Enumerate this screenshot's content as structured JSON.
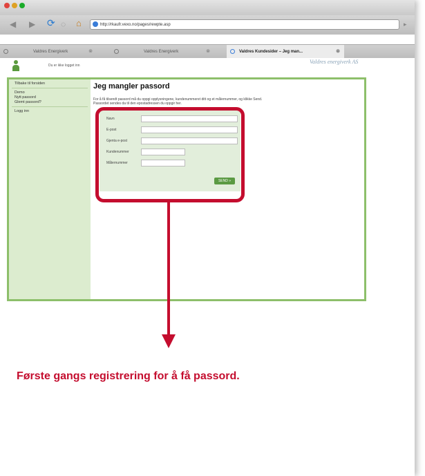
{
  "browser": {
    "url": "http://rkaufr.vexo.no/pages/rewpte.asp",
    "tabs": [
      {
        "label": "Valdres Energiverk"
      },
      {
        "label": "Valdres Energiverk"
      },
      {
        "label": "Valdres Kundesider – Jeg man..."
      }
    ]
  },
  "header": {
    "status": "Du er ikke logget inn",
    "logo_text": "Valdres energiverk AS"
  },
  "sidebar": {
    "items": [
      {
        "label": "Tilbake til forsiden"
      },
      {
        "label": "Demo"
      },
      {
        "label": "Nytt passord"
      },
      {
        "label": "Glemt passord?"
      },
      {
        "label": "Logg inn"
      }
    ]
  },
  "main": {
    "title": "Jeg mangler passord",
    "intro": "For å få tilsendt passord må du oppgi opplysningene, kundenummeret ditt og et målernummer, og klikke Send. Passordet sendes da til den epostadressen du oppgir her."
  },
  "form": {
    "fields": [
      {
        "label": "Navn"
      },
      {
        "label": "E-post"
      },
      {
        "label": "Gjenta e-post"
      },
      {
        "label": "Kundenummer"
      },
      {
        "label": "Målernummer"
      }
    ],
    "submit_label": "SEND »"
  },
  "annotation": {
    "caption": "Første gangs registrering for å få passord.",
    "color": "#c40d2e"
  }
}
